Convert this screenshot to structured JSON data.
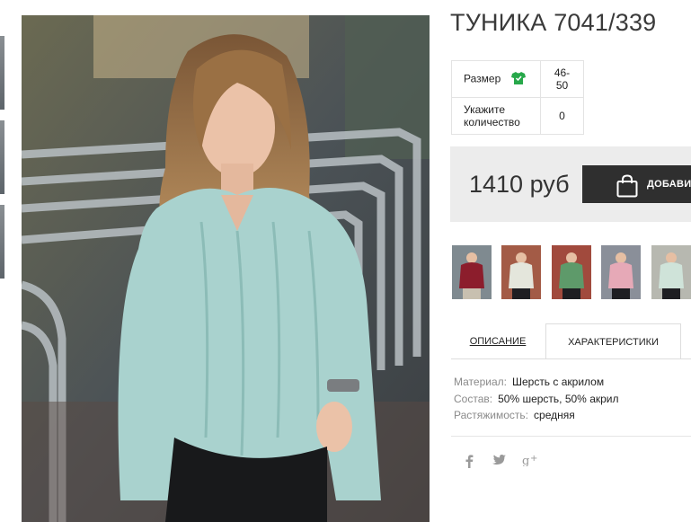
{
  "product": {
    "title": "ТУНИКА 7041/339",
    "size_label": "Размер",
    "size_value": "46-50",
    "qty_label": "Укажите количество",
    "qty_value": "0",
    "price": "1410 руб",
    "add_button": "ДОБАВИТЬ"
  },
  "tabs": {
    "description": "ОПИСАНИЕ",
    "characteristics": "ХАРАКТЕРИСТИКИ"
  },
  "specs": [
    {
      "key": "Материал:",
      "value": "Шерсть с акрилом"
    },
    {
      "key": "Состав:",
      "value": "50% шерсть, 50% акрил"
    },
    {
      "key": "Растяжимость:",
      "value": "средняя"
    }
  ],
  "variants": [
    {
      "color": "#8c1d2c"
    },
    {
      "color": "#e4e6dc"
    },
    {
      "color": "#5e9a6a"
    },
    {
      "color": "#e6a9b7"
    },
    {
      "color": "#cfe3d9"
    }
  ],
  "icons": {
    "size": "tshirt-icon",
    "add": "shopping-bag-icon",
    "social": [
      "facebook-icon",
      "twitter-icon",
      "google-plus-icon"
    ]
  },
  "colors": {
    "accent_green": "#27a84a",
    "button_dark": "#2f2f2f",
    "price_bg": "#ececec"
  }
}
